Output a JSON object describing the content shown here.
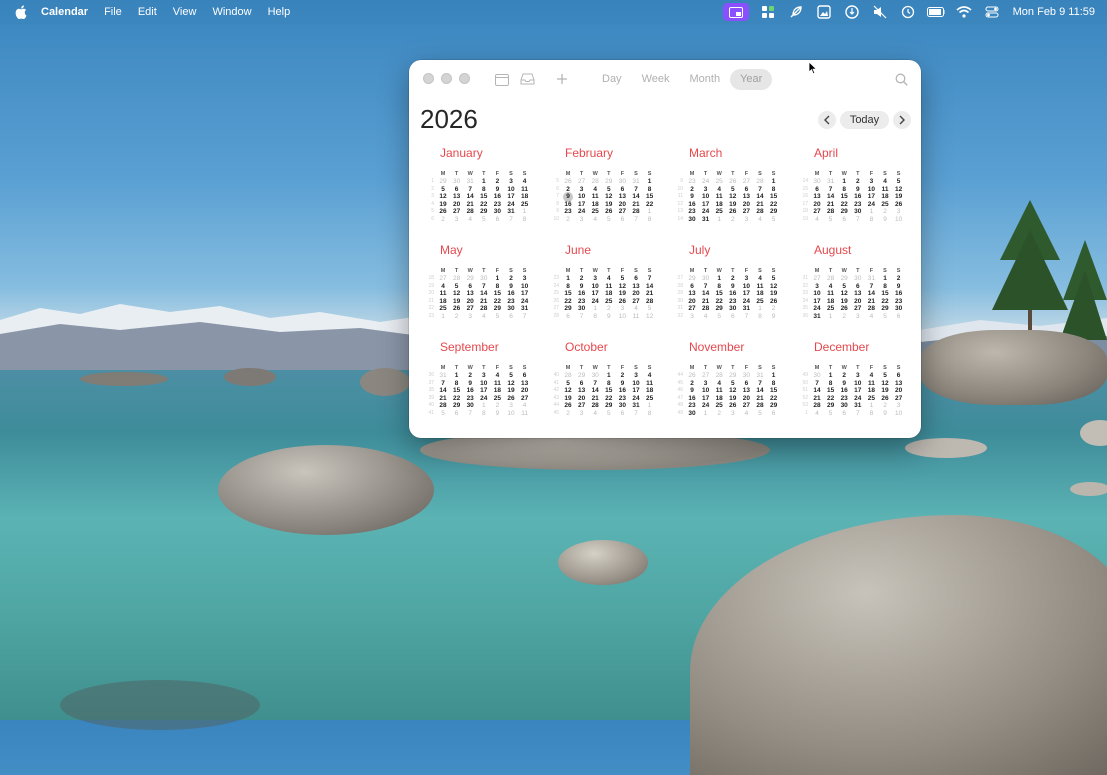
{
  "menubar": {
    "app_name": "Calendar",
    "menus": [
      "File",
      "Edit",
      "View",
      "Window",
      "Help"
    ],
    "clock": "Mon Feb 9  11:59",
    "status_icons": [
      "screen-mirroring-icon",
      "shortcuts-icon",
      "feather-icon",
      "photo-icon",
      "vpn-icon",
      "mute-icon",
      "time-machine-icon",
      "battery-icon",
      "wifi-icon",
      "control-center-icon"
    ]
  },
  "window": {
    "view_tabs": [
      "Day",
      "Week",
      "Month",
      "Year"
    ],
    "active_view": "Year",
    "year": "2026",
    "today_label": "Today",
    "today_date": "2026-02-09",
    "weekday_headers": [
      "M",
      "T",
      "W",
      "T",
      "F",
      "S",
      "S"
    ],
    "months": [
      "January",
      "February",
      "March",
      "April",
      "May",
      "June",
      "July",
      "August",
      "September",
      "October",
      "November",
      "December"
    ]
  },
  "colors": {
    "month_name": "#e5484d",
    "active_tab_bg": "#e6e6e6",
    "today_marker": "#c8c8c8"
  }
}
